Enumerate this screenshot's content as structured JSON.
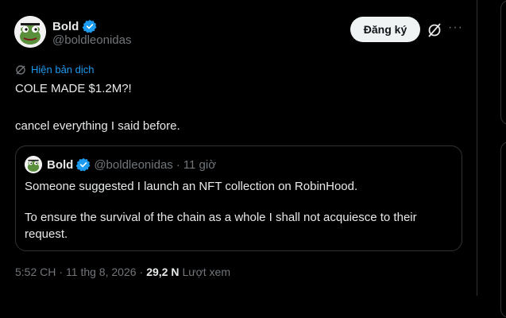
{
  "author": {
    "name": "Bold",
    "handle": "@boldleonidas"
  },
  "actions": {
    "follow_label": "Đăng ký",
    "more_label": "···"
  },
  "translate_label": "Hiện bản dịch",
  "tweet": {
    "line1": "COLE MADE $1.2M?!",
    "line2": "cancel everything I said before."
  },
  "quote": {
    "name": "Bold",
    "handle": "@boldleonidas",
    "separator": "·",
    "time": "11 giờ",
    "line1": "Someone suggested I launch an NFT collection on RobinHood.",
    "line2": "To ensure the survival of the chain as a whole I shall not acquiesce to their",
    "line3": "request."
  },
  "meta": {
    "time": "5:52 CH",
    "dot1": "·",
    "date": "11 thg 8, 2026",
    "dot2": "·",
    "views": "29,2 N",
    "views_label": "Lượt xem"
  },
  "colors": {
    "accent": "#1d9bf0",
    "background": "#000000",
    "text": "#e7e9ea",
    "muted": "#71767b",
    "border": "#2f3336"
  }
}
